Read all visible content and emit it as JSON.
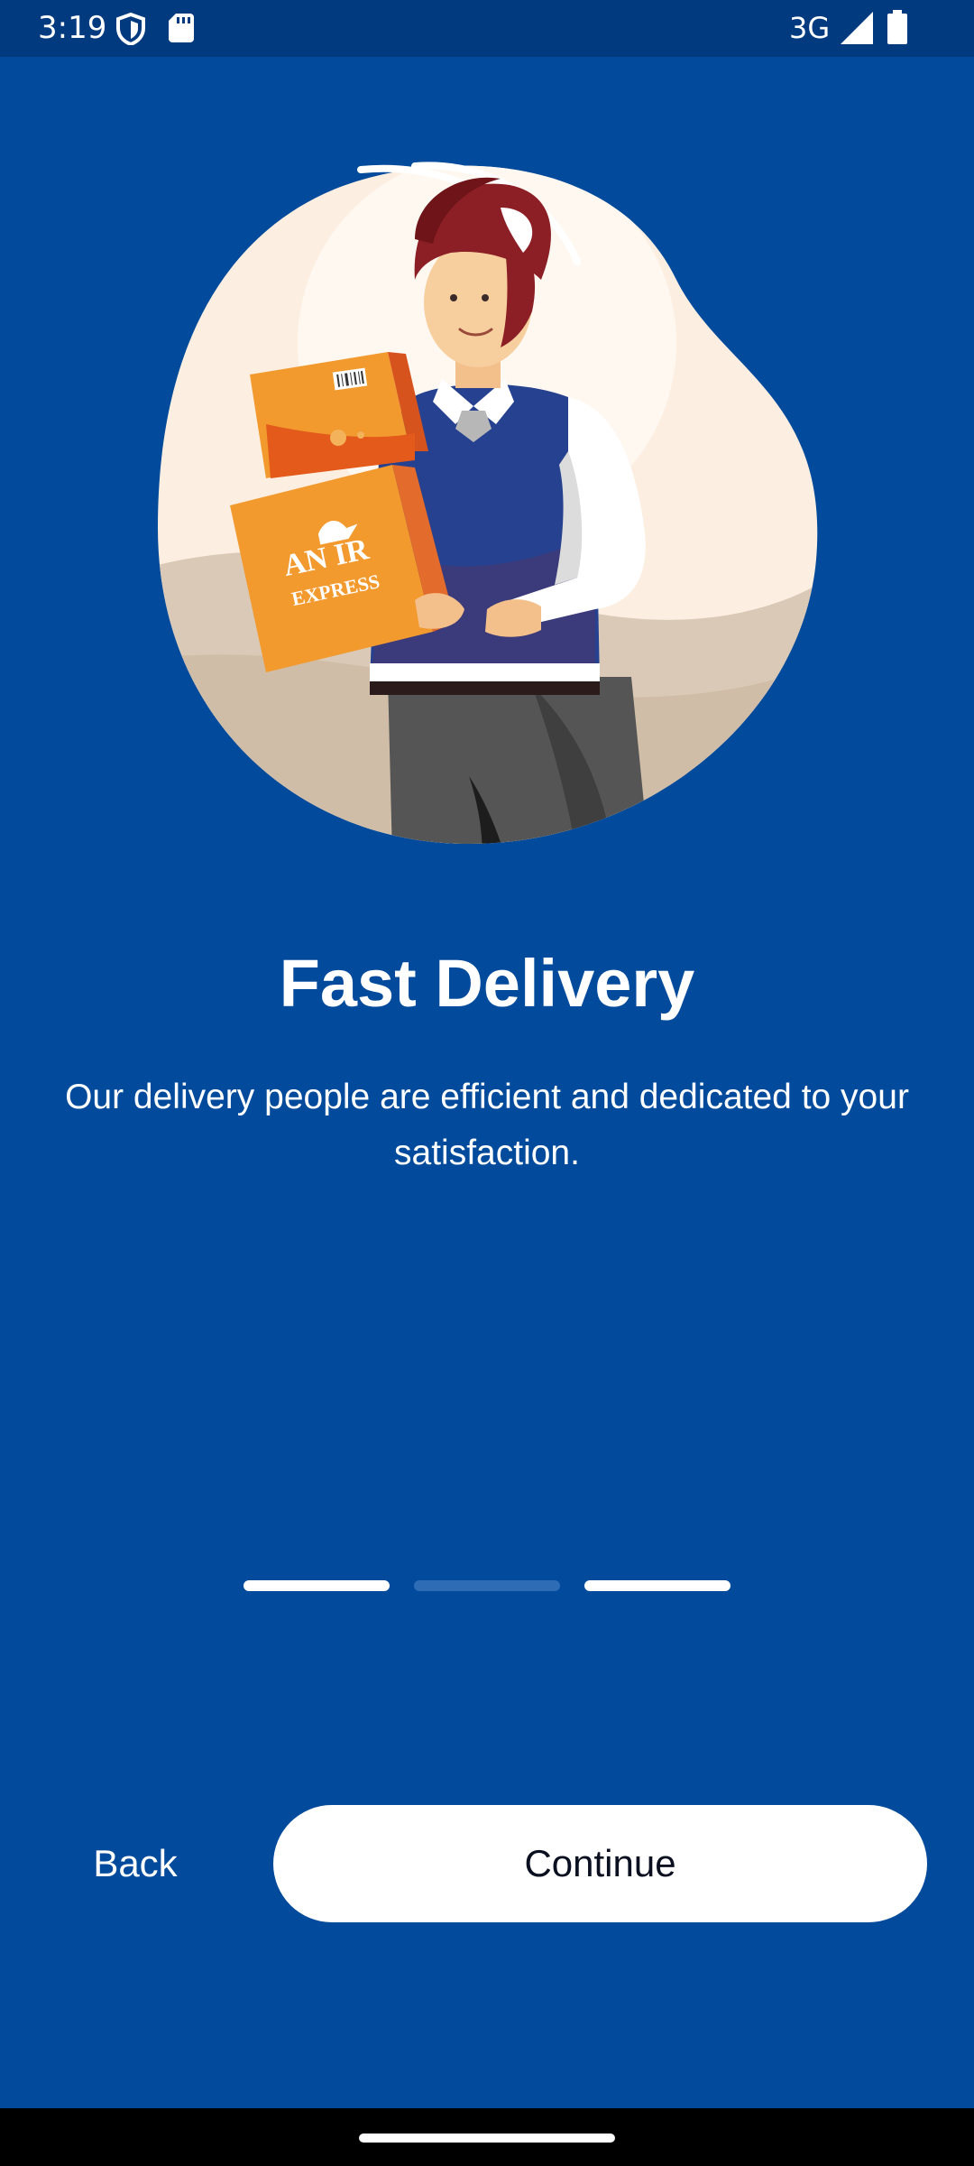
{
  "status_bar": {
    "time": "3:19",
    "network": "3G",
    "icons": [
      "shield-icon",
      "sd-card-icon",
      "signal-icon",
      "battery-icon"
    ]
  },
  "onboarding": {
    "illustration": {
      "icon": "delivery-person-illustration",
      "box_label_line1": "AN IR",
      "box_label_line2": "EXPRESS"
    },
    "title": "Fast Delivery",
    "description": "Our delivery people are efficient and dedicated to your satisfaction.",
    "page_indicator": {
      "count": 3,
      "active_index": 1
    }
  },
  "actions": {
    "back_label": "Back",
    "continue_label": "Continue"
  },
  "colors": {
    "background": "#024a9b",
    "status_bar": "#023a80",
    "button_bg": "#ffffff",
    "button_text": "#0b1020",
    "indicator_inactive": "#2f6cb6"
  }
}
